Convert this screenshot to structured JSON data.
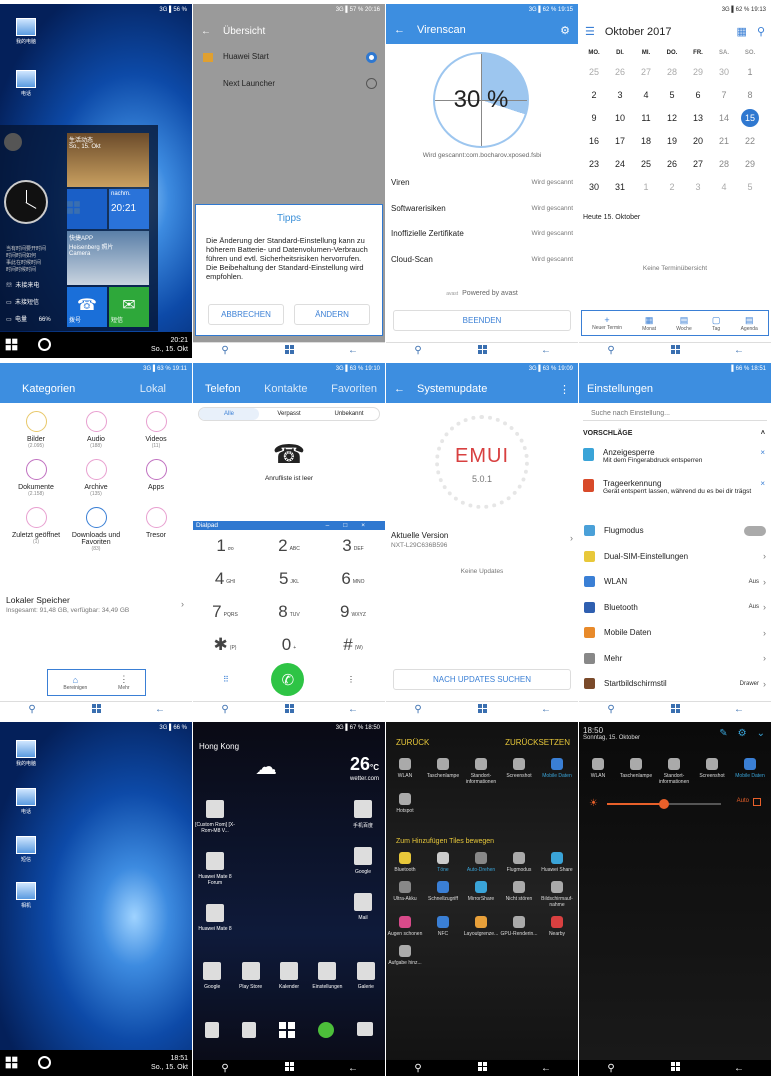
{
  "p1": {
    "status": "3G ▌56 %",
    "icons": [
      "我的电脑",
      "电话"
    ],
    "live_title": "生活动态",
    "date_small": "So., 15. Okt",
    "tile_time_label": "nachm.",
    "tile_time": "20:21",
    "tile_app": "快捷APP",
    "tile_photo_title": "Heisenberg 照片",
    "tile_camera": "Camera",
    "missed_call": "未接来电",
    "missed_msg": "未接短信",
    "battery_label": "电量",
    "battery": "66%",
    "phone_label": "拨号",
    "sms_label": "短信",
    "taskbar_time": "20:21",
    "taskbar_date": "So., 15. Okt",
    "lang_lines": [
      "当有时间要开时间",
      "时间时间如何",
      "事此在时候时间",
      "时间时候时间"
    ]
  },
  "p2": {
    "status": "3G ▌57 % 20:16",
    "title": "Übersicht",
    "opt1": "Huawei Start",
    "opt2": "Next Launcher",
    "dlg_title": "Tipps",
    "dlg_text": "Die Änderung der Standard-Einstellung kann zu höherem Batterie- und Datenvolumen-Verbrauch führen und evtl. Sicherheitsrisiken hervorrufen. Die Beibehaltung der Standard-Einstellung wird empfohlen.",
    "cancel": "ABBRECHEN",
    "change": "ÄNDERN"
  },
  "p3": {
    "status": "3G ▌62 % 19:15",
    "title": "Virenscan",
    "percent": "30 %",
    "percent_value": 30,
    "scanning": "Wird gescannt:com.bocharov.xposed.fsbi",
    "rows": [
      {
        "label": "Viren",
        "status": "Wird gescannt"
      },
      {
        "label": "Softwarerisiken",
        "status": "Wird gescannt"
      },
      {
        "label": "Inoffizielle Zertifikate",
        "status": "Wird gescannt"
      },
      {
        "label": "Cloud-Scan",
        "status": "Wird gescannt"
      }
    ],
    "powered": "Powered by avast",
    "avast": "avast",
    "end_btn": "BEENDEN"
  },
  "p4": {
    "status": "3G ▌62 % 19:13",
    "title": "Oktober 2017",
    "days": [
      "MO.",
      "DI.",
      "MI.",
      "DO.",
      "FR.",
      "SA.",
      "SO."
    ],
    "weeks": [
      [
        "25",
        "26",
        "27",
        "28",
        "29",
        "30",
        "1"
      ],
      [
        "2",
        "3",
        "4",
        "5",
        "6",
        "7",
        "8"
      ],
      [
        "9",
        "10",
        "11",
        "12",
        "13",
        "14",
        "15"
      ],
      [
        "16",
        "17",
        "18",
        "19",
        "20",
        "21",
        "22"
      ],
      [
        "23",
        "24",
        "25",
        "26",
        "27",
        "28",
        "29"
      ],
      [
        "30",
        "31",
        "1",
        "2",
        "3",
        "4",
        "5"
      ]
    ],
    "today_label": "Heute  15. Oktober",
    "no_events": "Keine Terminübersicht",
    "bottom": [
      "Neuer Termin",
      "Monat",
      "Woche",
      "Tag",
      "Agenda"
    ]
  },
  "p5": {
    "status": "3G ▌63 % 19:11",
    "tab1": "Kategorien",
    "tab2": "Lokal",
    "cats": [
      {
        "name": "Bilder",
        "count": "(2.095)"
      },
      {
        "name": "Audio",
        "count": "(188)"
      },
      {
        "name": "Videos",
        "count": "(11)"
      },
      {
        "name": "Dokumente",
        "count": "(2.158)"
      },
      {
        "name": "Archive",
        "count": "(135)"
      },
      {
        "name": "Apps",
        "count": ""
      },
      {
        "name": "Zuletzt geöffnet",
        "count": "(1)"
      },
      {
        "name": "Downloads und Favoriten",
        "count": "(83)"
      },
      {
        "name": "Tresor",
        "count": ""
      }
    ],
    "storage_title": "Lokaler Speicher",
    "storage_info": "Insgesamt: 91,48 GB, verfügbar: 34,49 GB",
    "bottom1": "Bereinigen",
    "bottom2": "Mehr"
  },
  "p6": {
    "status": "3G ▌63 % 19:10",
    "tabs": [
      "Telefon",
      "Kontakte",
      "Favoriten"
    ],
    "filters": [
      "Alle",
      "Verpasst",
      "Unbekannt"
    ],
    "empty": "Anrufliste ist leer",
    "dialpad": "Dialpad",
    "keys": [
      {
        "n": "1",
        "l": "σο"
      },
      {
        "n": "2",
        "l": "ABC"
      },
      {
        "n": "3",
        "l": "DEF"
      },
      {
        "n": "4",
        "l": "GHI"
      },
      {
        "n": "5",
        "l": "JKL"
      },
      {
        "n": "6",
        "l": "MNO"
      },
      {
        "n": "7",
        "l": "PQRS"
      },
      {
        "n": "8",
        "l": "TUV"
      },
      {
        "n": "9",
        "l": "WXYZ"
      },
      {
        "n": "✱",
        "l": "(P)"
      },
      {
        "n": "0",
        "l": "+"
      },
      {
        "n": "#",
        "l": "(W)"
      }
    ]
  },
  "p7": {
    "status": "3G ▌63 % 19:09",
    "title": "Systemupdate",
    "version": "5.0.1",
    "current_label": "Aktuelle Version",
    "current_value": "NXT-L29C636B596",
    "no_updates": "Keine Updates",
    "btn": "NACH UPDATES SUCHEN",
    "logo": "EMUI"
  },
  "p8": {
    "status": "▌66 % 18:51",
    "title": "Einstellungen",
    "search_placeholder": "Suche nach Einstellung...",
    "suggest": "VORSCHLÄGE",
    "sug1_title": "Anzeigesperre",
    "sug1_sub": "Mit dem Fingerabdruck entsperren",
    "sug2_title": "Trageerkennung",
    "sug2_sub": "Gerät entsperrt lassen, während du es bei dir trägst",
    "rows": [
      {
        "label": "Flugmodus",
        "value": ""
      },
      {
        "label": "Dual-SIM-Einstellungen",
        "value": ""
      },
      {
        "label": "WLAN",
        "value": "Aus"
      },
      {
        "label": "Bluetooth",
        "value": "Aus"
      },
      {
        "label": "Mobile Daten",
        "value": ""
      },
      {
        "label": "Mehr",
        "value": ""
      },
      {
        "label": "Startbildschirmstil",
        "value": "Drawer"
      }
    ]
  },
  "p9": {
    "status": "3G ▌66 %",
    "icons": [
      "我的电脑",
      "电话",
      "短信",
      "相机"
    ],
    "time": "18:51",
    "date": "So., 15. Okt"
  },
  "p10": {
    "status": "3G ▌67 % 18:50",
    "city": "Hong Kong",
    "temp": "26",
    "unit": "°C",
    "brand": "wetter.com",
    "left_apps": [
      "[Custom Rom] [X-Rom-M8 V...",
      "Huawei Mate 8 Forum",
      "Huawei Mate 8"
    ],
    "right_apps": [
      "手机百度",
      "Google",
      "Mail"
    ],
    "dock": [
      "Google",
      "Play Store",
      "Kalender",
      "Einstellungen",
      "Galerie"
    ]
  },
  "p11": {
    "back": "ZURÜCK",
    "reset": "ZURÜCKSETZEN",
    "active": [
      "WLAN",
      "Taschenlampe",
      "Standort-informationen",
      "Screenshot",
      "Mobile Daten",
      "Hotspot"
    ],
    "add_title": "Zum Hinzufügen Tiles bewegen",
    "available": [
      "Bluetooth",
      "Töne",
      "Auto-Drehen",
      "Flugmodus",
      "Huawei Share",
      "Ultra-Akku",
      "Schnellzugriff",
      "MirrorShare",
      "Nicht stören",
      "Bildschirmauf-nahme",
      "Augen schonen",
      "NFC",
      "Layoutgrenze...",
      "GPU-Renderin...",
      "Nearby",
      "Aufgabe hinz..."
    ]
  },
  "p12": {
    "time": "18:50",
    "date": "Sonntag, 15. Oktober",
    "tiles": [
      "WLAN",
      "Taschenlampe",
      "Standort-informationen",
      "Screenshot",
      "Mobile Daten"
    ],
    "auto": "Auto",
    "brightness_value": 0.5
  }
}
